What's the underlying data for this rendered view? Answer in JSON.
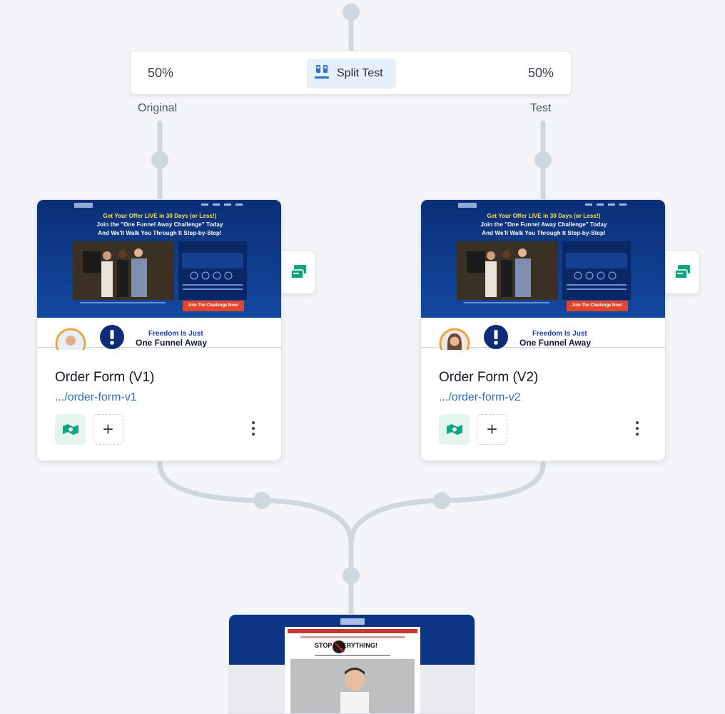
{
  "split_test": {
    "label": "Split Test",
    "left_percent": "50%",
    "right_percent": "50%",
    "icon": "split-test-icon"
  },
  "branches": {
    "original_label": "Original",
    "test_label": "Test"
  },
  "thumbnail_text": {
    "headline_1": "Get Your Offer LIVE in 30 Days (or Less!)",
    "headline_2": "Join the \"One Funnel Away Challenge\" Today",
    "headline_3": "And We'll Walk You Through It Step-by-Step!",
    "cta": "Join The Challenge Now!"
  },
  "cards": [
    {
      "name": "Order Form (V1)",
      "url": ".../order-form-v1",
      "freedom_line_1": "Freedom Is Just",
      "freedom_line_2": "One Funnel Away",
      "avatar": "avatar-man"
    },
    {
      "name": "Order Form (V2)",
      "url": ".../order-form-v2",
      "freedom_line_1": "Freedom Is Just",
      "freedom_line_2": "One Funnel Away",
      "avatar": "avatar-woman"
    }
  ],
  "bottom_card": {
    "headline": "STOP EVERYTHING!"
  },
  "colors": {
    "background": "#f3f5f8",
    "connector": "#cfd8de",
    "thumb_blue": "#0f3a8c",
    "accent_green": "#0fa37f",
    "link_blue": "#2f6fd1",
    "badge_bg": "#e6f0fb"
  }
}
